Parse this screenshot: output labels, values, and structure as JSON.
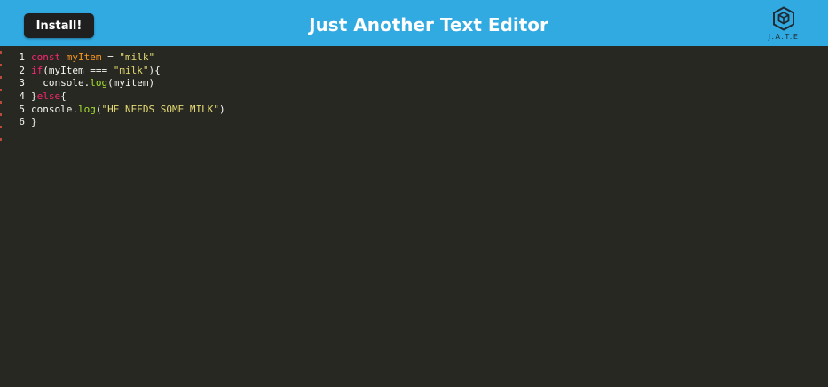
{
  "header": {
    "install_label": "Install!",
    "title": "Just Another Text Editor",
    "logo_text": "J.A.T.E",
    "background_color": "#31a9e1",
    "logo_icon": "cube-hexagon-icon"
  },
  "editor": {
    "theme_background": "#272822",
    "lines": [
      {
        "number": "1",
        "tokens": [
          {
            "text": "const",
            "kind": "kw"
          },
          {
            "text": " ",
            "kind": "pl"
          },
          {
            "text": "myItem",
            "kind": "var"
          },
          {
            "text": " = ",
            "kind": "pl"
          },
          {
            "text": "\"milk\"",
            "kind": "str"
          }
        ]
      },
      {
        "number": "2",
        "tokens": [
          {
            "text": "if",
            "kind": "kw"
          },
          {
            "text": "(myItem === ",
            "kind": "pl"
          },
          {
            "text": "\"milk\"",
            "kind": "str"
          },
          {
            "text": "){",
            "kind": "pl"
          }
        ]
      },
      {
        "number": "3",
        "tokens": [
          {
            "text": "  console.",
            "kind": "pl"
          },
          {
            "text": "log",
            "kind": "fn"
          },
          {
            "text": "(myitem)",
            "kind": "pl"
          }
        ]
      },
      {
        "number": "4",
        "tokens": [
          {
            "text": "}",
            "kind": "pl"
          },
          {
            "text": "else",
            "kind": "kw"
          },
          {
            "text": "{",
            "kind": "pl"
          }
        ]
      },
      {
        "number": "5",
        "tokens": [
          {
            "text": "console.",
            "kind": "pl"
          },
          {
            "text": "log",
            "kind": "fn"
          },
          {
            "text": "(",
            "kind": "pl"
          },
          {
            "text": "\"HE NEEDS SOME MILK\"",
            "kind": "str"
          },
          {
            "text": ")",
            "kind": "pl"
          }
        ]
      },
      {
        "number": "6",
        "tokens": [
          {
            "text": "}",
            "kind": "pl"
          }
        ]
      }
    ]
  }
}
